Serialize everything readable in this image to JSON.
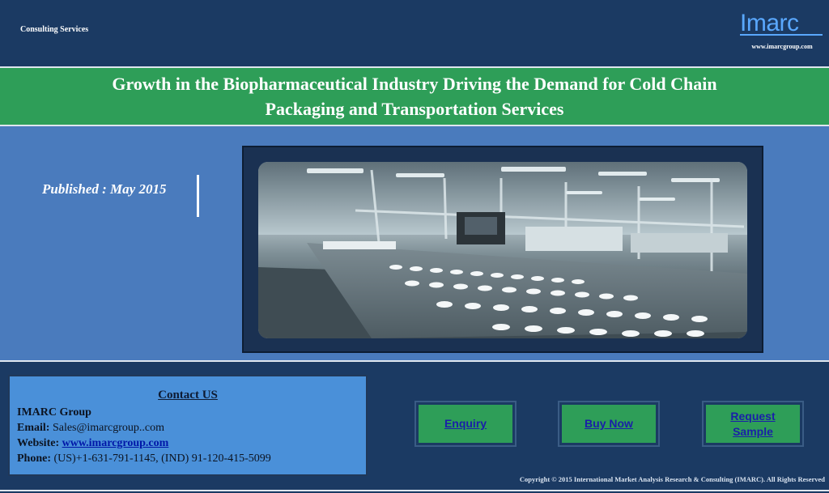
{
  "header": {
    "tagline": "Consulting Services",
    "logo_text": "Imarc",
    "website_small": "www.imarcgroup.com"
  },
  "title": {
    "line1": "Growth in the Biopharmaceutical Industry Driving the Demand for Cold Chain",
    "line2": "Packaging and Transportation Services"
  },
  "published": "Published : May 2015",
  "contact": {
    "heading": "Contact US",
    "company": "IMARC Group",
    "email_label": "Email:",
    "email_value": "Sales@imarcgroup..com",
    "website_label": "Website:",
    "website_value": "www.imarcgroup.com",
    "phone_label": "Phone:",
    "phone_value": "(US)+1-631-791-1145,  (IND) 91-120-415-5099"
  },
  "buttons": {
    "enquiry": "Enquiry",
    "buy_now": "Buy Now",
    "request_line1": "Request",
    "request_line2": "Sample"
  },
  "copyright": "Copyright © 2015  International Market Analysis Research & Consulting (IMARC). All Rights Reserved",
  "colors": {
    "navy": "#1b3a63",
    "green": "#2e9e58",
    "mid_blue": "#4a7bbd",
    "contact_blue": "#4a90d9",
    "logo_blue": "#5aa8ff"
  }
}
